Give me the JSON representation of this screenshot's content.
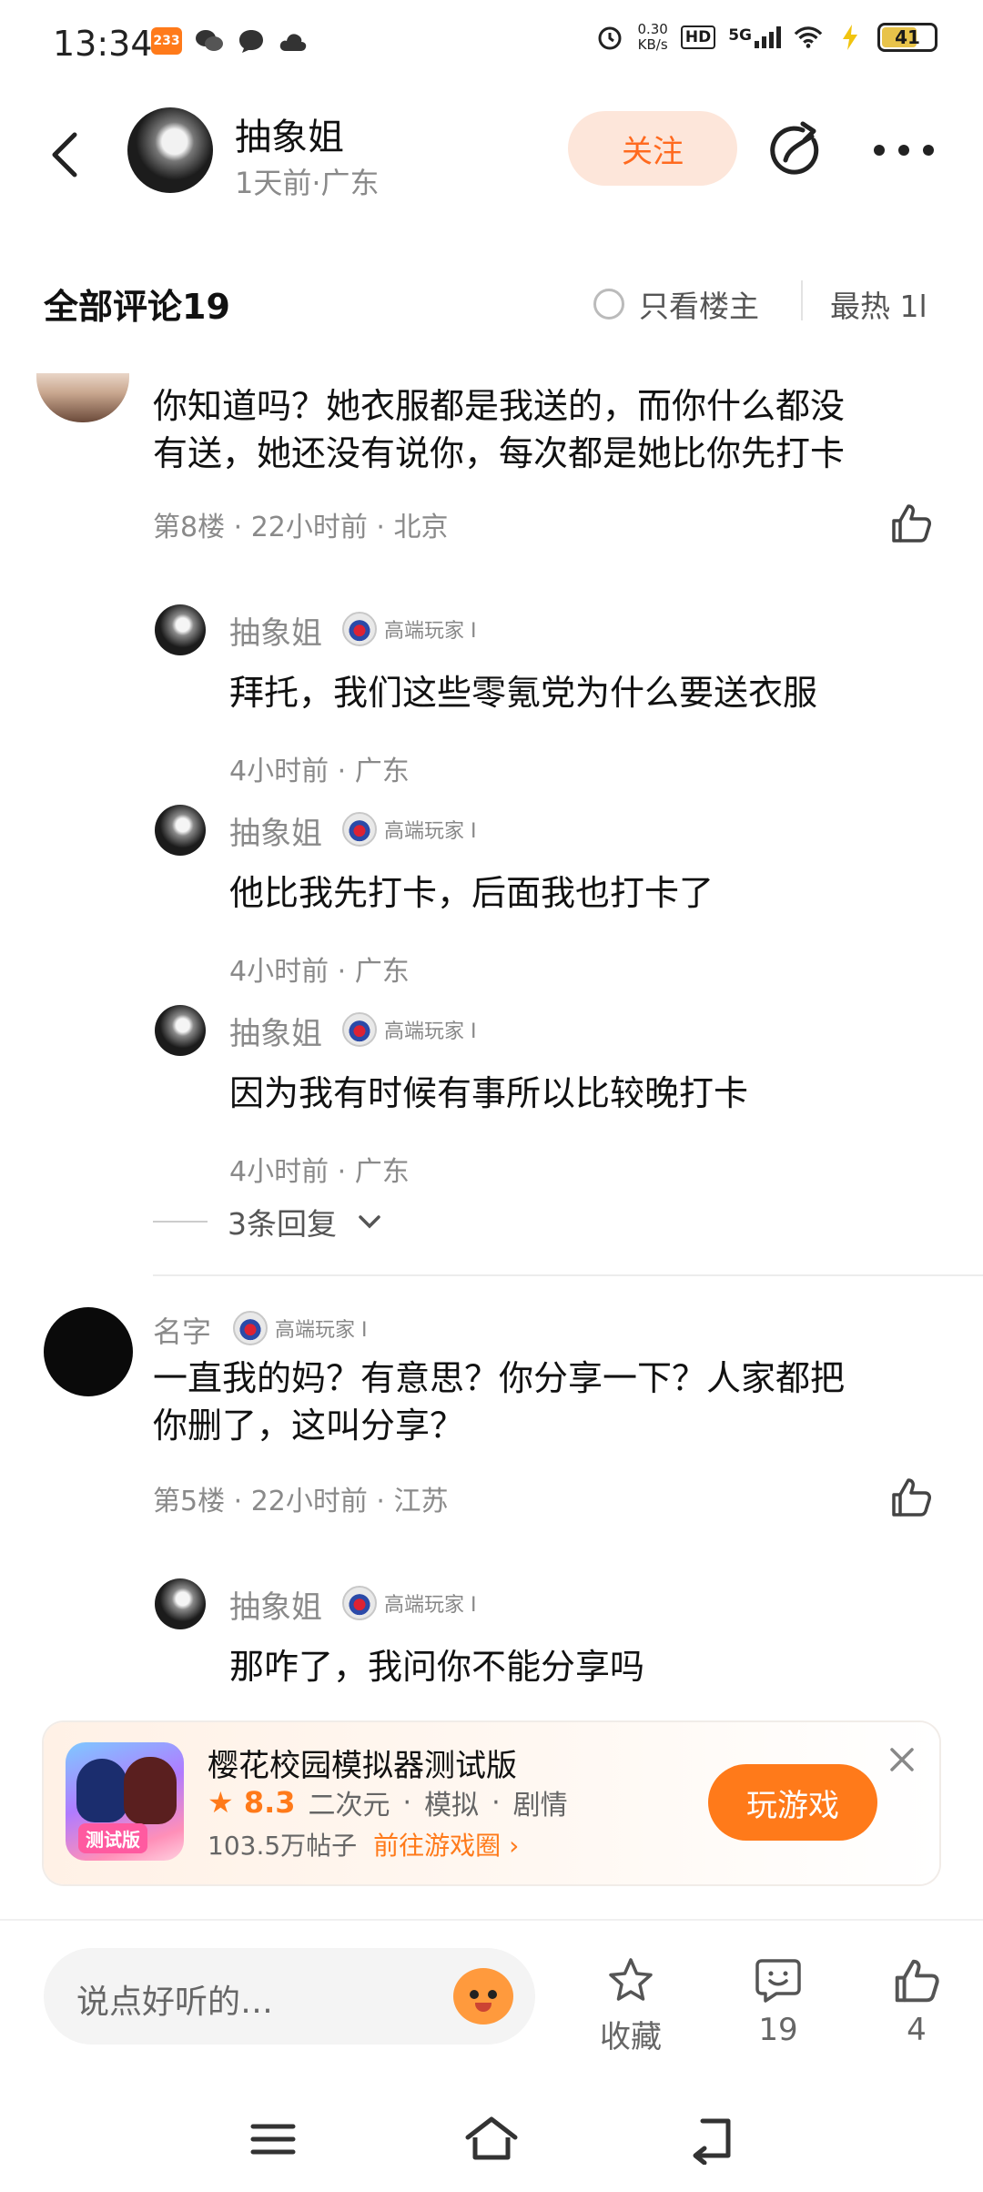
{
  "status_bar": {
    "time": "13:34",
    "app_badge": "233",
    "net_speed_value": "0.30",
    "net_speed_unit": "KB/s",
    "hd_label": "HD",
    "signal_label": "5G",
    "battery": "41"
  },
  "header": {
    "author_name": "抽象姐",
    "author_meta": "1天前·广东",
    "follow_label": "关注"
  },
  "comments_bar": {
    "title": "全部评论19",
    "only_op_label": "只看楼主",
    "sort_label": "最热 1l"
  },
  "comments": [
    {
      "text_line1": "你知道吗？她衣服都是我送的，而你什么都没",
      "text_line2": "有送，她还没有说你，每次都是她比你先打卡",
      "meta": "第8楼 · 22小时前 · 北京",
      "replies": [
        {
          "name": "抽象姐",
          "badge": "高端玩家 I",
          "text": "拜托，我们这些零氪党为什么要送衣服",
          "meta": "4小时前 · 广东"
        },
        {
          "name": "抽象姐",
          "badge": "高端玩家 I",
          "text": "他比我先打卡，后面我也打卡了",
          "meta": "4小时前 · 广东"
        },
        {
          "name": "抽象姐",
          "badge": "高端玩家 I",
          "text": "因为我有时候有事所以比较晚打卡",
          "meta": "4小时前 · 广东"
        }
      ],
      "more_replies_label": "3条回复"
    },
    {
      "name": "名字",
      "badge": "高端玩家 I",
      "text_line1": "一直我的妈？有意思？你分享一下？人家都把",
      "text_line2": "你删了，这叫分享？",
      "meta": "第5楼 · 22小时前 · 江苏",
      "replies": [
        {
          "name": "抽象姐",
          "badge": "高端玩家 I",
          "text": "那咋了，我问你不能分享吗"
        }
      ]
    }
  ],
  "game_card": {
    "title": "樱花校园模拟器测试版",
    "rating": "8.3",
    "tags": [
      "二次元",
      "·",
      "模拟",
      "·",
      "剧情"
    ],
    "posts": "103.5万帖子",
    "link_label": "前往游戏圈",
    "play_label": "玩游戏",
    "icon_tag": "测试版"
  },
  "bottom_bar": {
    "input_placeholder": "说点好听的…",
    "favorite_label": "收藏",
    "comment_count": "19",
    "like_count": "4"
  }
}
